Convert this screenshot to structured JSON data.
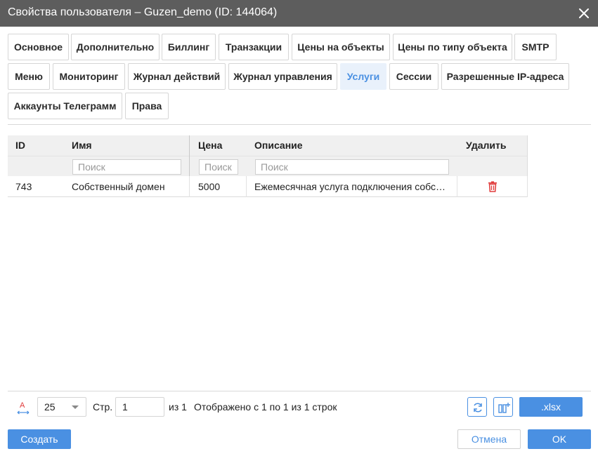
{
  "dialog": {
    "title": "Свойства пользователя – Guzen_demo (ID: 144064)"
  },
  "tabs": [
    {
      "label": "Основное",
      "active": false
    },
    {
      "label": "Дополнительно",
      "active": false
    },
    {
      "label": "Биллинг",
      "active": false
    },
    {
      "label": "Транзакции",
      "active": false
    },
    {
      "label": "Цены на объекты",
      "active": false
    },
    {
      "label": "Цены по типу объекта",
      "active": false
    },
    {
      "label": "SMTP",
      "active": false
    },
    {
      "label": "Меню",
      "active": false
    },
    {
      "label": "Мониторинг",
      "active": false
    },
    {
      "label": "Журнал действий",
      "active": false
    },
    {
      "label": "Журнал управления",
      "active": false
    },
    {
      "label": "Услуги",
      "active": true
    },
    {
      "label": "Сессии",
      "active": false
    },
    {
      "label": "Разрешенные IP-адреса",
      "active": false
    },
    {
      "label": "Аккаунты Телеграмм",
      "active": false
    },
    {
      "label": "Права",
      "active": false
    }
  ],
  "table": {
    "columns": [
      "ID",
      "Имя",
      "Цена",
      "Описание",
      "Удалить"
    ],
    "filters": {
      "name_placeholder": "Поиск",
      "price_placeholder": "Поиск",
      "description_placeholder": "Поиск"
    },
    "rows": [
      {
        "id": "743",
        "name": "Собственный домен",
        "price": "5000",
        "description": "Ежемесячная услуга подключения собс…"
      }
    ]
  },
  "pager": {
    "page_size": "25",
    "page_label": "Стр.",
    "page": "1",
    "of_pages": "из 1",
    "summary": "Отображено с 1 по 1 из 1 строк",
    "export_label": ".xlsx"
  },
  "footer": {
    "create_label": "Создать",
    "cancel_label": "Отмена",
    "ok_label": "OK"
  },
  "colors": {
    "accent": "#4a90e2",
    "titlebar": "#5d5d5d",
    "delete": "#e03b3b"
  },
  "icons": [
    "close-icon",
    "trash-icon",
    "font-size-icon",
    "chevron-down-icon",
    "refresh-icon",
    "columns-icon"
  ]
}
